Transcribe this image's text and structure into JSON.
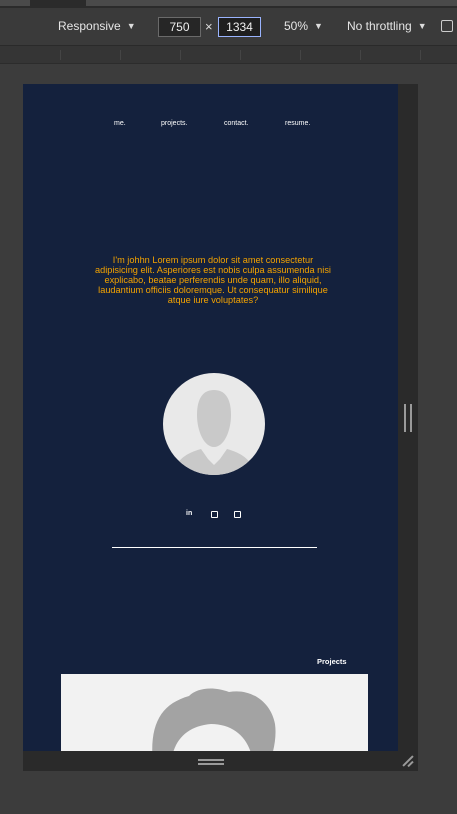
{
  "devtools": {
    "device_label": "Responsive",
    "width_value": "750",
    "height_value": "1334",
    "zoom_label": "50%",
    "throttle_label": "No throttling"
  },
  "page": {
    "nav": [
      "me.",
      "projects.",
      "contact.",
      "resume."
    ],
    "intro": "I'm johhn Lorem ipsum dolor sit amet consectetur adipisicing elit. Asperiores est nobis culpa assumenda nisi explicabo, beatae perferendis unde quam, illo aliquid, laudantium officiis doloremque. Ut consequatur similique atque iure voluptates?",
    "social_linkedin": "in",
    "projects_heading": "Projects"
  },
  "colors": {
    "page_background": "#14213d",
    "intro_text": "#f4a300",
    "devtools_bar": "#3a3a3a"
  },
  "icons": [
    "chevron-down-icon",
    "rotate-icon",
    "avatar-placeholder-icon",
    "linkedin-icon",
    "instagram-icon",
    "github-icon"
  ]
}
